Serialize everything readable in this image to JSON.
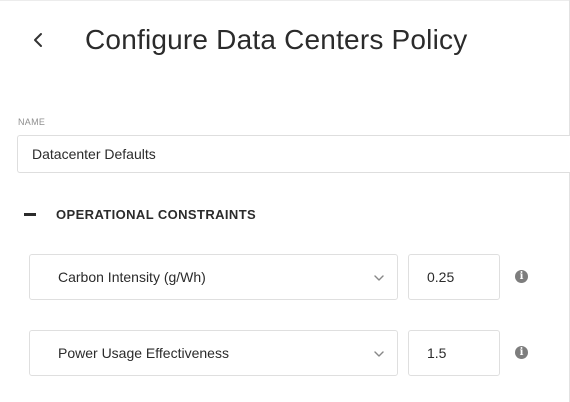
{
  "header": {
    "back_icon": "chevron-left-icon",
    "title": "Configure Data Centers Policy"
  },
  "name_field": {
    "label": "NAME",
    "value": "Datacenter Defaults"
  },
  "section": {
    "collapse_icon": "minus-icon",
    "title": "OPERATIONAL CONSTRAINTS"
  },
  "constraints": [
    {
      "metric": "Carbon Intensity (g/Wh)",
      "value": "0.25",
      "dropdown_icon": "chevron-down-icon",
      "info_icon": "info-icon"
    },
    {
      "metric": "Power Usage Effectiveness",
      "value": "1.5",
      "dropdown_icon": "chevron-down-icon",
      "info_icon": "info-icon"
    }
  ],
  "colors": {
    "text": "#2b2b2b",
    "border": "#dfdfdf",
    "label": "#8f8f8f",
    "icon": "#7d7d7d"
  }
}
